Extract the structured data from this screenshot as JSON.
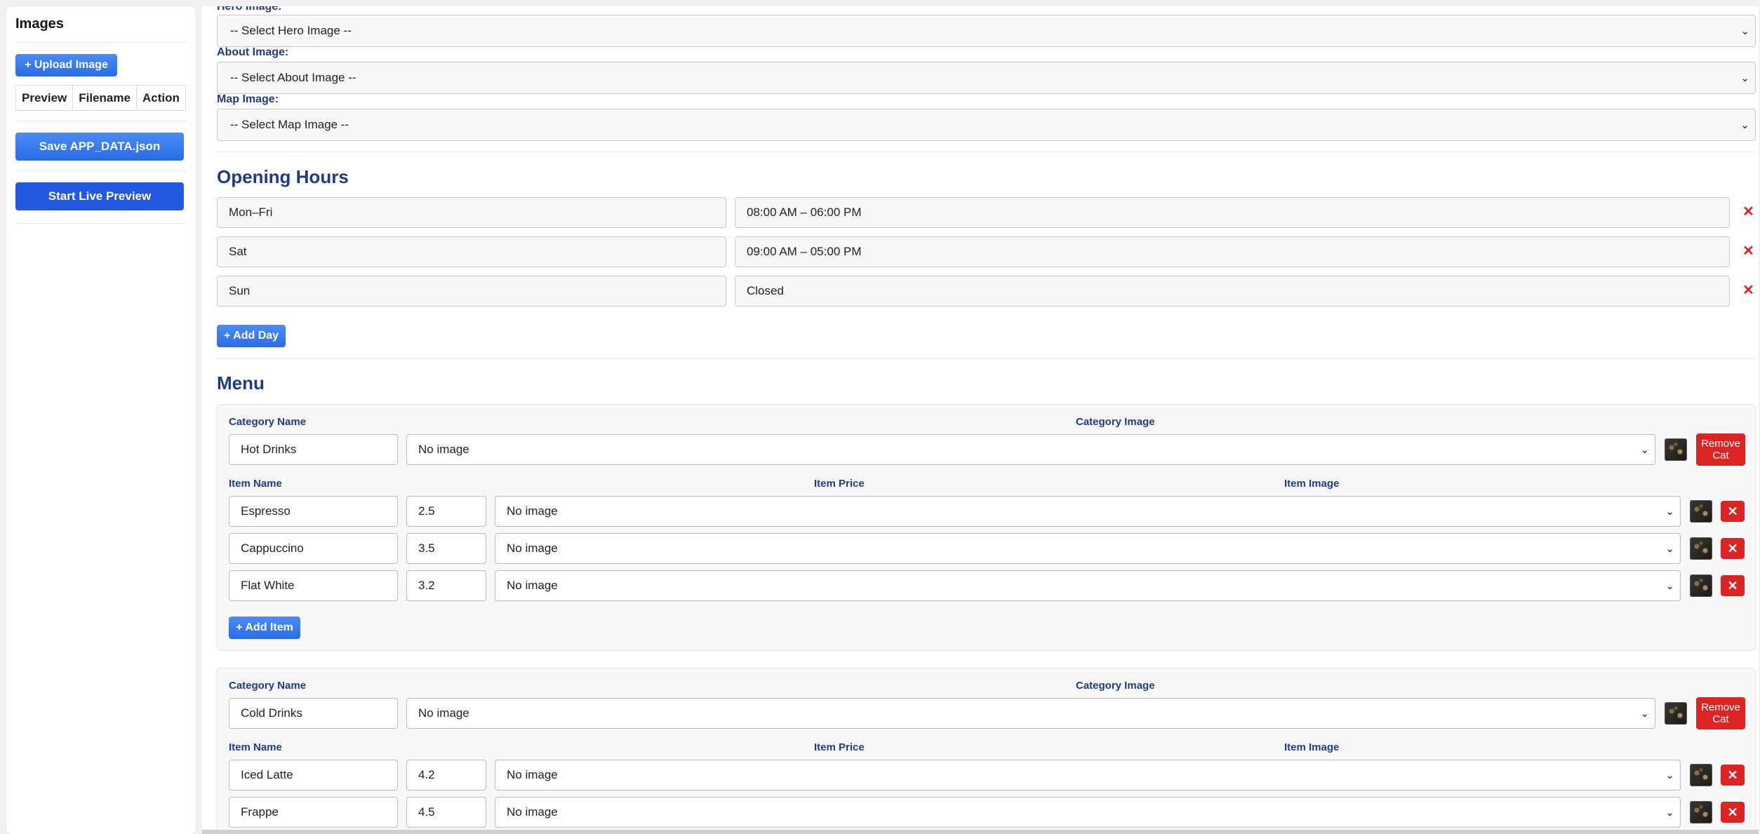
{
  "sidebar": {
    "title": "Images",
    "upload_label": "+ Upload Image",
    "table_headers": [
      "Preview",
      "Filename",
      "Action"
    ],
    "save_label": "Save APP_DATA.json",
    "preview_label": "Start Live Preview"
  },
  "images": {
    "hero_label": "Hero Image:",
    "hero_value": "-- Select Hero Image --",
    "about_label": "About Image:",
    "about_value": "-- Select About Image --",
    "map_label": "Map Image:",
    "map_value": "-- Select Map Image --"
  },
  "hours": {
    "title": "Opening Hours",
    "rows": [
      {
        "day": "Mon–Fri",
        "time": "08:00 AM – 06:00 PM"
      },
      {
        "day": "Sat",
        "time": "09:00 AM – 05:00 PM"
      },
      {
        "day": "Sun",
        "time": "Closed"
      }
    ],
    "remove_glyph": "✕",
    "add_label": "+ Add Day"
  },
  "menu": {
    "title": "Menu",
    "labels": {
      "category_name": "Category Name",
      "category_image": "Category Image",
      "item_name": "Item Name",
      "item_price": "Item Price",
      "item_image": "Item Image",
      "remove_cat": "Remove Cat",
      "add_item": "+ Add Item",
      "remove_item": "✕"
    },
    "categories": [
      {
        "name": "Hot Drinks",
        "image": "No image",
        "items": [
          {
            "name": "Espresso",
            "price": "2.5",
            "image": "No image"
          },
          {
            "name": "Cappuccino",
            "price": "3.5",
            "image": "No image"
          },
          {
            "name": "Flat White",
            "price": "3.2",
            "image": "No image"
          }
        ]
      },
      {
        "name": "Cold Drinks",
        "image": "No image",
        "items": [
          {
            "name": "Iced Latte",
            "price": "4.2",
            "image": "No image"
          },
          {
            "name": "Frappe",
            "price": "4.5",
            "image": "No image"
          }
        ]
      }
    ]
  },
  "icons": {
    "dropdown": "chevron-down-icon",
    "thumbnail": "image-thumbnail-icon",
    "close": "close-icon"
  },
  "colors": {
    "accent": "#2b6be6",
    "heading": "#1f3a8a",
    "danger": "#dd2424"
  }
}
